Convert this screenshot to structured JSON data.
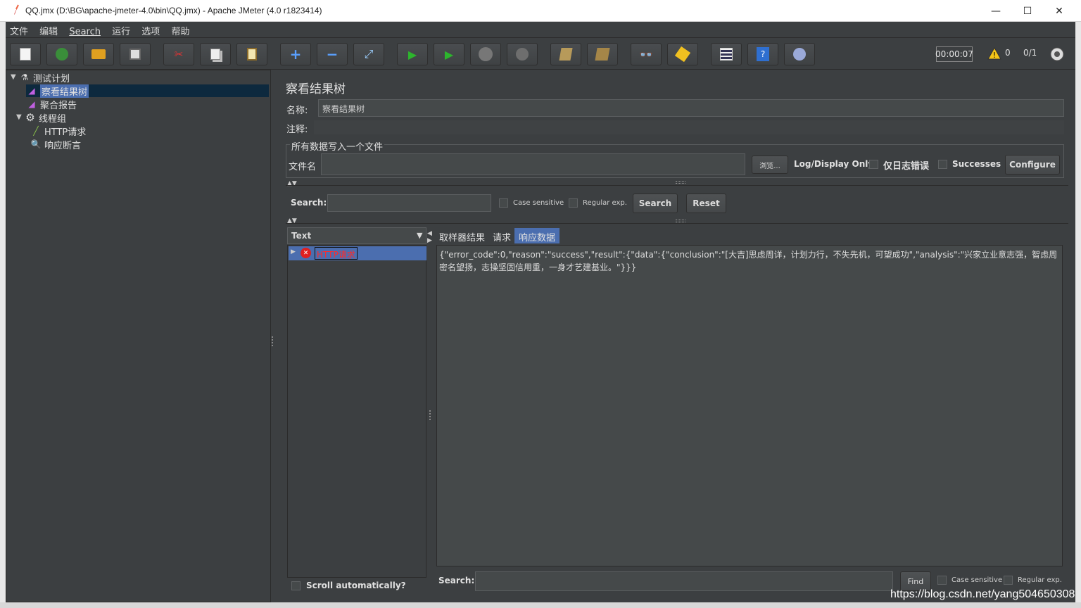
{
  "window": {
    "title": "QQ.jmx (D:\\BG\\apache-jmeter-4.0\\bin\\QQ.jmx) - Apache JMeter (4.0 r1823414)",
    "minimize": "—",
    "maximize": "☐",
    "close": "✕"
  },
  "menu": [
    "文件",
    "编辑",
    "Search",
    "运行",
    "选项",
    "帮助"
  ],
  "toolbar": {
    "timer": "00:00:07",
    "warnings": "0",
    "threads": "0/1"
  },
  "tree": {
    "items": [
      {
        "label": "测试计划",
        "icon": "flask-icon"
      },
      {
        "label": "察看结果树",
        "icon": "chart-icon"
      },
      {
        "label": "聚合报告",
        "icon": "chart-icon"
      },
      {
        "label": "线程组",
        "icon": "gear-icon"
      },
      {
        "label": "HTTP请求",
        "icon": "pipette-icon"
      },
      {
        "label": "响应断言",
        "icon": "magnifier-icon"
      }
    ]
  },
  "panel": {
    "title": "察看结果树",
    "name_label": "名称:",
    "name_value": "察看结果树",
    "comment_label": "注释:",
    "file_group_title": "所有数据写入一个文件",
    "filename_label": "文件名",
    "browse_button": "浏览...",
    "log_display_label": "Log/Display Only:",
    "errors_only_label": "仅日志错误",
    "successes_label": "Successes",
    "configure_button": "Configure"
  },
  "search": {
    "label": "Search:",
    "case_sensitive": "Case sensitive",
    "regular_exp": "Regular exp.",
    "search_button": "Search",
    "reset_button": "Reset"
  },
  "results": {
    "renderer": "Text",
    "sample_label": "HTTP请求",
    "scroll_auto": "Scroll automatically?",
    "tabs": [
      "取样器结果",
      "请求",
      "响应数据"
    ],
    "response_text": "{\"error_code\":0,\"reason\":\"success\",\"result\":{\"data\":{\"conclusion\":\"[大吉]思虑周详，计划力行，不失先机，可望成功\",\"analysis\":\"兴家立业意志强，智虑周密名望扬，志操坚固信用重，一身才艺建基业。\"}}}",
    "bottom_search_label": "Search:",
    "find_button": "Find",
    "bottom_case_sensitive": "Case sensitive",
    "bottom_regular_exp": "Regular exp."
  },
  "watermark": "https://blog.csdn.net/yang504650308"
}
